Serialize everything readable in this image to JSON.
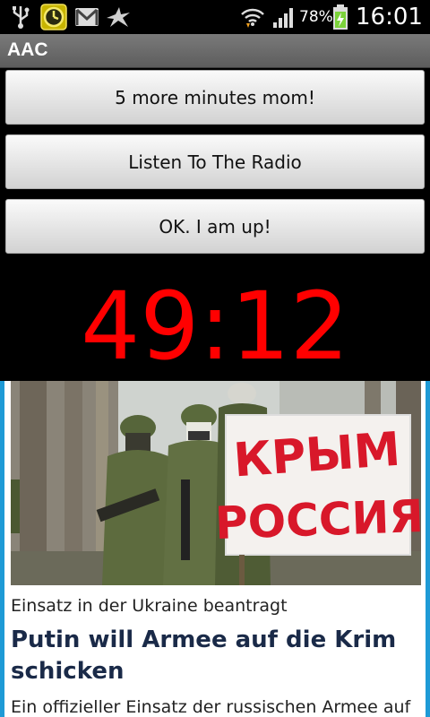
{
  "status_bar": {
    "battery_percent": "78%",
    "time": "16:01",
    "icons": [
      "usb-icon",
      "alarm-clock-icon",
      "gmail-icon",
      "bird-notification-icon",
      "wifi-icon",
      "signal-icon",
      "battery-charging-icon"
    ]
  },
  "app": {
    "title": "AAC"
  },
  "buttons": {
    "snooze_label": "5 more minutes mom!",
    "radio_label": "Listen To The Radio",
    "up_label": "OK. I am up!"
  },
  "timer": {
    "display": "49:12",
    "color": "#ff0000"
  },
  "news": {
    "sign_line1": "КРЫМ",
    "sign_line2": "РОССИЯ",
    "kicker": "Einsatz in der Ukraine beantragt",
    "headline": "Putin will Armee auf die Krim schicken",
    "teaser": "Ein offizieller Einsatz der russischen Armee auf"
  },
  "colors": {
    "accent_border": "#1e9ad6",
    "headline": "#1a2a48"
  }
}
